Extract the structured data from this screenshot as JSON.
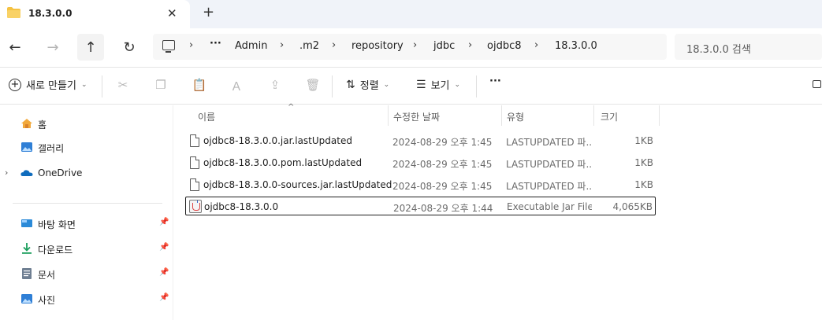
{
  "tab": {
    "title": "18.3.0.0",
    "close": "✕",
    "new_tab": "+"
  },
  "nav": {
    "back": "←",
    "forward": "→",
    "up": "↑",
    "refresh": "↻"
  },
  "address": {
    "more": "···",
    "crumbs": [
      "Admin",
      ".m2",
      "repository",
      "jdbc",
      "ojdbc8",
      "18.3.0.0"
    ],
    "sep": "›"
  },
  "search": {
    "placeholder": "18.3.0.0 검색"
  },
  "toolbar": {
    "new_label": "새로 만들기",
    "sort_label": "정렬",
    "view_label": "보기",
    "more": "···"
  },
  "sidebar": {
    "home": "홈",
    "gallery": "갤러리",
    "onedrive": "OneDrive",
    "desktop": "바탕 화면",
    "downloads": "다운로드",
    "documents": "문서",
    "pictures": "사진"
  },
  "columns": {
    "name": "이름",
    "date": "수정한 날짜",
    "type": "유형",
    "size": "크기"
  },
  "files": [
    {
      "name": "ojdbc8-18.3.0.0.jar.lastUpdated",
      "date": "2024-08-29 오후 1:45",
      "type": "LASTUPDATED 파...",
      "size": "1KB"
    },
    {
      "name": "ojdbc8-18.3.0.0.pom.lastUpdated",
      "date": "2024-08-29 오후 1:45",
      "type": "LASTUPDATED 파...",
      "size": "1KB"
    },
    {
      "name": "ojdbc8-18.3.0.0-sources.jar.lastUpdated",
      "date": "2024-08-29 오후 1:45",
      "type": "LASTUPDATED 파...",
      "size": "1KB"
    },
    {
      "name": "ojdbc8-18.3.0.0",
      "date": "2024-08-29 오후 1:44",
      "type": "Executable Jar File",
      "size": "4,065KB"
    }
  ],
  "colors": {
    "folder": "#f5c242",
    "accent_blue": "#0067c0",
    "download_green": "#1a9e5c"
  }
}
